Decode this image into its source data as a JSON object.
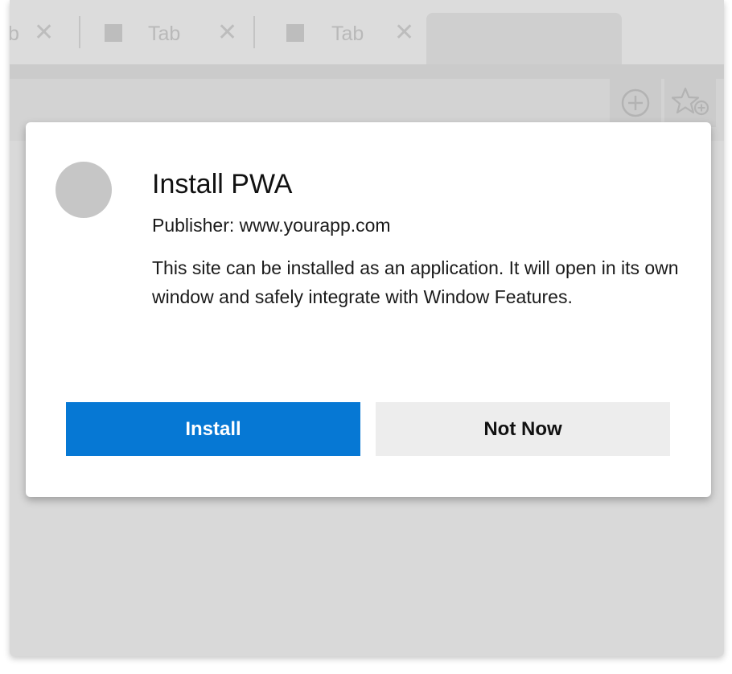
{
  "tabs": [
    {
      "title": "b",
      "close": "✕"
    },
    {
      "title": "Tab",
      "close": "✕"
    },
    {
      "title": "Tab",
      "close": "✕"
    }
  ],
  "toolbar": {
    "add_icon": "circle-plus-icon",
    "favorite_icon": "star-plus-icon"
  },
  "dialog": {
    "title": "Install PWA",
    "publisher": "Publisher: www.yourapp.com",
    "description": "This site can be installed as an application. It will open in its own window and safely integrate with Window Features.",
    "install_label": "Install",
    "not_now_label": "Not Now"
  },
  "colors": {
    "install_bg": "#0678d4",
    "not_now_bg": "#ededed",
    "backdrop": "#d9d9d9"
  }
}
